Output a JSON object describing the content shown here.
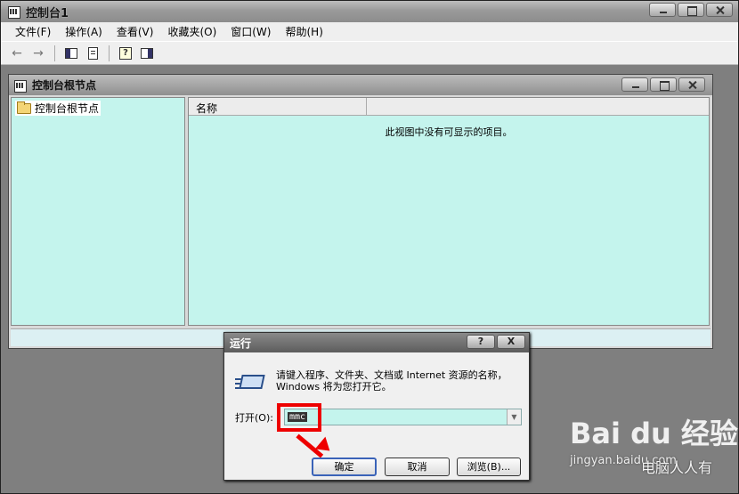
{
  "main_window": {
    "title": "控制台1",
    "menu": [
      "文件(F)",
      "操作(A)",
      "查看(V)",
      "收藏夹(O)",
      "窗口(W)",
      "帮助(H)"
    ]
  },
  "child_window": {
    "title": "控制台根节点",
    "tree_root": "控制台根节点",
    "column_name": "名称",
    "empty_message": "此视图中没有可显示的项目。"
  },
  "run_dialog": {
    "title": "运行",
    "help_label": "?",
    "close_label": "X",
    "description": "请键入程序、文件夹、文档或 Internet 资源的名称，Windows 将为您打开它。",
    "open_label": "打开(O):",
    "open_value": "mmc",
    "ok_label": "确定",
    "cancel_label": "取消",
    "browse_label": "浏览(B)..."
  },
  "watermark": {
    "logo": "Bai du 经验",
    "url": "jingyan.baidu.com",
    "author": "电脑人人有"
  },
  "colors": {
    "pane_bg": "#c4f4ed",
    "highlight_red": "#e00000"
  }
}
